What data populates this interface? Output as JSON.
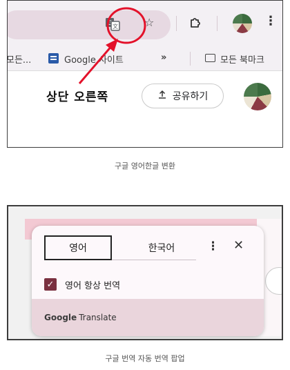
{
  "figure1": {
    "bookmarks": {
      "truncated_left": "모든...",
      "sites": "Google 사이트",
      "overflow": "»",
      "all_bookmarks": "모든 북마크"
    },
    "annotation": "상단 오른쪽",
    "share_label": "공유하기",
    "caption": "구글 영어한글 변환",
    "highlight_color": "#e3112a"
  },
  "figure2": {
    "popup": {
      "tab_source": "영어",
      "tab_target": "한국어",
      "always_translate": "영어 항상 번역",
      "always_translate_checked": true,
      "footer_brand": "Google",
      "footer_product": "Translate"
    },
    "caption": "구글 번역 자동 번역 팝업"
  },
  "icons": {
    "translate": "translate-icon",
    "star": "star-icon",
    "extensions": "puzzle-icon",
    "menu": "kebab-menu-icon",
    "share": "upload-icon",
    "close": "close-icon",
    "folder": "folder-icon"
  }
}
